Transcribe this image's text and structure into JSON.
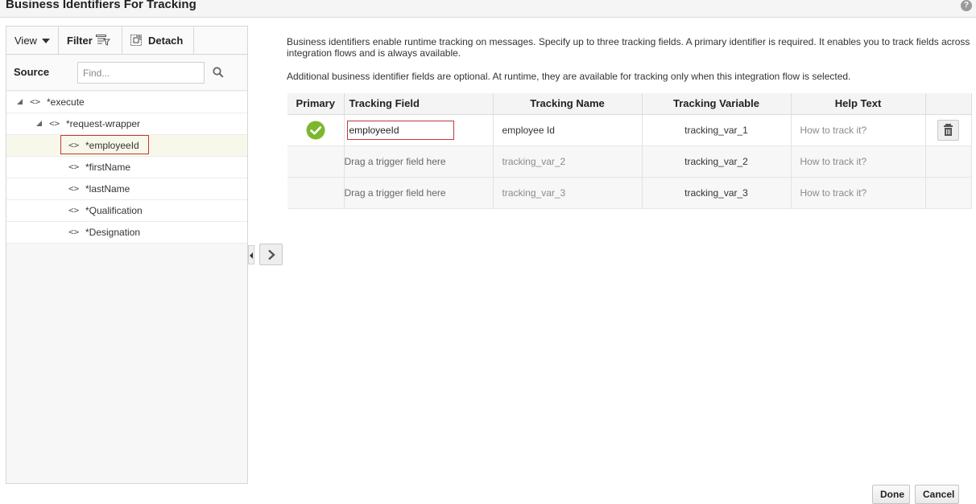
{
  "dialog": {
    "title": "Business Identifiers For Tracking",
    "help_icon": "question-icon"
  },
  "toolbar": {
    "view_label": "View",
    "filter_label": "Filter",
    "detach_label": "Detach"
  },
  "source": {
    "label": "Source",
    "find_placeholder": "Find..."
  },
  "tree": {
    "items": [
      {
        "label": "*execute"
      },
      {
        "label": "*request-wrapper"
      },
      {
        "label": "*employeeId"
      },
      {
        "label": "*firstName"
      },
      {
        "label": "*lastName"
      },
      {
        "label": "*Qualification"
      },
      {
        "label": "*Designation"
      }
    ]
  },
  "description": {
    "line1": "Business identifiers enable runtime tracking on messages. Specify up to three tracking fields. A primary identifier is required. It enables you to track fields across integration flows and is always available.",
    "line2": "Additional business identifier fields are optional. At runtime, they are available for tracking only when this integration flow is selected."
  },
  "table": {
    "headers": [
      "Primary",
      "Tracking Field",
      "Tracking Name",
      "Tracking Variable",
      "Help Text"
    ],
    "rows": [
      {
        "tracking_field": "employeeId",
        "tracking_name": "employee Id",
        "tracking_variable": "tracking_var_1",
        "help_text": "How to track it?"
      },
      {
        "tracking_field": "Drag a trigger field here",
        "tracking_name": "tracking_var_2",
        "tracking_variable": "tracking_var_2",
        "help_text": "How to track it?"
      },
      {
        "tracking_field": "Drag a trigger field here",
        "tracking_name": "tracking_var_3",
        "tracking_variable": "tracking_var_3",
        "help_text": "How to track it?"
      }
    ]
  },
  "buttons": {
    "done": "Done",
    "cancel": "Cancel"
  },
  "colors": {
    "primary_check": "#7cb82f",
    "highlight_border": "#c73636"
  }
}
